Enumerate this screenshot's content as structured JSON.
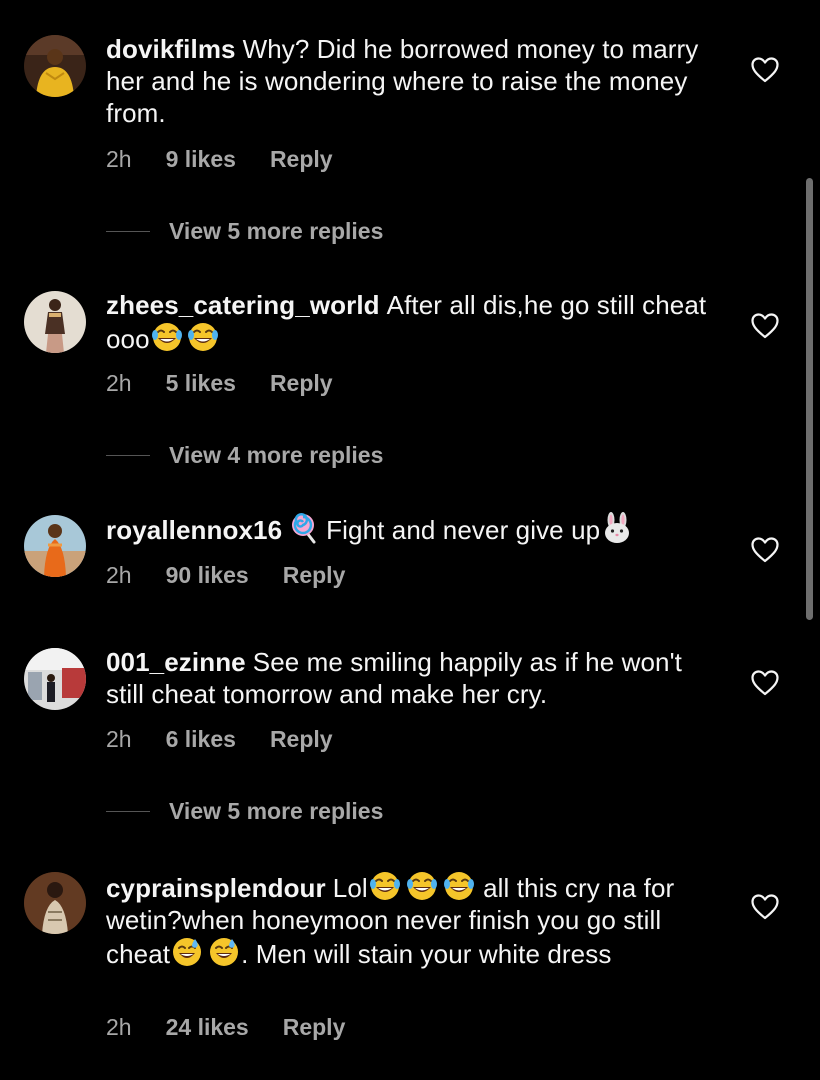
{
  "comments": [
    {
      "username": "dovikfilms",
      "text": "Why? Did he borrowed money to marry her and he is wondering where to raise the money from.",
      "time": "2h",
      "likes": "9 likes",
      "reply": "Reply",
      "view_replies": "View 5 more replies"
    },
    {
      "username": "zhees_catering_world",
      "text": "After all dis,he go still cheat ooo",
      "time": "2h",
      "likes": "5 likes",
      "reply": "Reply",
      "view_replies": "View 4 more replies"
    },
    {
      "username": "royallennox16",
      "text_after_lollipop": "Fight and never give up",
      "time": "2h",
      "likes": "90 likes",
      "reply": "Reply"
    },
    {
      "username": "001_ezinne",
      "text": "See me smiling happily as if he won't still cheat tomorrow and make her cry.",
      "time": "2h",
      "likes": "6 likes",
      "reply": "Reply",
      "view_replies": "View 5 more replies"
    },
    {
      "username": "cyprainsplendour",
      "text_1": "Lol",
      "text_2": " all this cry na for wetin?when honeymoon never finish you go still cheat",
      "text_3": ". Men will stain your white dress",
      "time": "2h",
      "likes": "24 likes",
      "reply": "Reply"
    }
  ],
  "icons": {
    "like": "heart-outline-icon",
    "laugh": "tears-of-joy-emoji",
    "sweat": "grinning-sweat-emoji",
    "lollipop": "lollipop-emoji",
    "rabbit": "rabbit-face-emoji"
  },
  "colors": {
    "background": "#000000",
    "text": "#f5f5f5",
    "secondary": "#a8a8a8"
  }
}
